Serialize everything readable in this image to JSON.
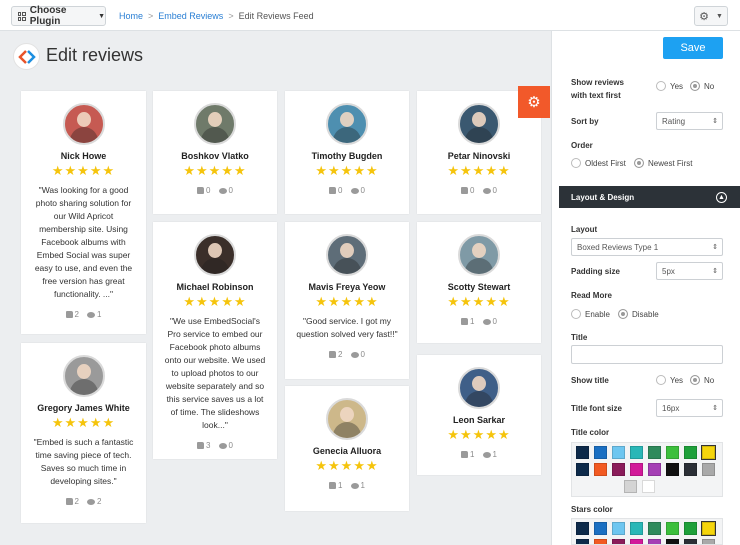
{
  "topbar": {
    "plugin_button": "Choose Plugin",
    "breadcrumbs": [
      "Home",
      "Embed Reviews",
      "Edit Reviews Feed"
    ],
    "separator": ">"
  },
  "header": {
    "title": "Edit reviews"
  },
  "reviews": [
    {
      "name": "Nick Howe",
      "stars": "★★★★★",
      "text": "\"Was looking for a good photo sharing solution for our Wild Apricot membership site. Using Facebook albums with Embed Social was super easy to use, and even the free version has great functionality. ...\"",
      "likes": "2",
      "comments": "1",
      "avatar_color": "#c65a52"
    },
    {
      "name": "Boshkov Vlatko",
      "stars": "★★★★★",
      "text": "",
      "likes": "0",
      "comments": "0",
      "avatar_color": "#6f7a6a"
    },
    {
      "name": "Timothy Bugden",
      "stars": "★★★★★",
      "text": "",
      "likes": "0",
      "comments": "0",
      "avatar_color": "#4e8fb0"
    },
    {
      "name": "Petar Ninovski",
      "stars": "★★★★★",
      "text": "",
      "likes": "0",
      "comments": "0",
      "avatar_color": "#3a5870"
    },
    {
      "name": "Michael Robinson",
      "stars": "★★★★★",
      "text": "\"We use EmbedSocial's Pro service to embed our Facebook photo albums onto our website. We used to upload photos to our website separately and so this service saves us a lot of time. The slideshows look...\"",
      "likes": "3",
      "comments": "0",
      "avatar_color": "#3b2f2a"
    },
    {
      "name": "Mavis Freya Yeow",
      "stars": "★★★★★",
      "text": "\"Good service. I got my question solved very fast!!\"",
      "likes": "2",
      "comments": "0",
      "avatar_color": "#5e6d78"
    },
    {
      "name": "Scotty Stewart",
      "stars": "★★★★★",
      "text": "",
      "likes": "1",
      "comments": "0",
      "avatar_color": "#7f9aa6"
    },
    {
      "name": "Gregory James White",
      "stars": "★★★★★",
      "text": "\"Embed is such a fantastic time saving piece of tech. Saves so much time in developing sites.\"",
      "likes": "2",
      "comments": "2",
      "avatar_color": "#9a9a9a"
    },
    {
      "name": "Genecia Alluora",
      "stars": "★★★★★",
      "text": "",
      "likes": "1",
      "comments": "1",
      "avatar_color": "#cdb88a"
    },
    {
      "name": "Leon Sarkar",
      "stars": "★★★★★",
      "text": "",
      "likes": "1",
      "comments": "1",
      "avatar_color": "#3f5f88"
    }
  ],
  "panel": {
    "save": "Save",
    "show_reviews_label_1": "Show reviews",
    "show_reviews_label_2": "with text first",
    "yes": "Yes",
    "no": "No",
    "sort_by_label": "Sort by",
    "sort_by_value": "Rating",
    "order_label": "Order",
    "oldest_first": "Oldest First",
    "newest_first": "Newest First",
    "section_title": "Layout & Design",
    "layout_label": "Layout",
    "layout_value": "Boxed Reviews Type 1",
    "padding_label": "Padding size",
    "padding_value": "5px",
    "read_more_label": "Read More",
    "enable": "Enable",
    "disable": "Disable",
    "title_label": "Title",
    "title_value": "",
    "show_title_label": "Show title",
    "title_font_label": "Title font size",
    "title_font_value": "16px",
    "title_color_label": "Title color",
    "stars_color_label": "Stars color"
  },
  "colors": {
    "accent": "#1da1f2",
    "orange": "#f2592a",
    "star": "#f5c40c",
    "section_bg": "#2c3238",
    "palette": [
      "#0d2a4a",
      "#1a6fc2",
      "#6ec6f0",
      "#2ab7b7",
      "#2f8a5c",
      "#3cbf3c",
      "#1ea03a",
      "#f5d50c",
      "#0d2a4a",
      "#f25a22",
      "#8a1c5a",
      "#d21a9a",
      "#a53fb5",
      "#111111",
      "#2b2f36",
      "#a9a9a9",
      "#d4d4d4",
      "#ffffff"
    ]
  }
}
